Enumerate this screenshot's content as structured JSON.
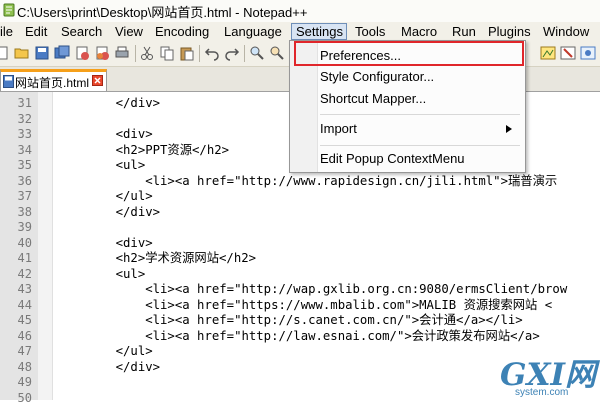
{
  "window": {
    "title": "C:\\Users\\print\\Desktop\\网站首页.html - Notepad++"
  },
  "menu": {
    "items": [
      "ile",
      "Edit",
      "Search",
      "View",
      "Encoding",
      "Language",
      "Settings",
      "Tools",
      "Macro",
      "Run",
      "Plugins",
      "Window"
    ],
    "active": "Settings"
  },
  "toolbar": {
    "buttons": [
      "new-file-icon",
      "open-file-icon",
      "save-icon",
      "save-all-icon",
      "close-icon",
      "close-all-icon",
      "print-icon",
      "cut-icon",
      "copy-icon",
      "paste-icon",
      "undo-icon",
      "redo-icon",
      "find-icon",
      "replace-icon",
      "zoom-in-icon",
      "zoom-out-icon",
      "sync-icon",
      "wrap-icon",
      "function-list-icon",
      "doc-map-icon",
      "record-icon"
    ]
  },
  "tab": {
    "label": "网站首页.html"
  },
  "settings_menu": {
    "items": [
      {
        "label": "Preferences..."
      },
      {
        "label": "Style Configurator..."
      },
      {
        "label": "Shortcut Mapper..."
      },
      {
        "label": "Import"
      },
      {
        "label": "Edit Popup ContextMenu"
      }
    ]
  },
  "editor": {
    "lines": [
      {
        "num": "31",
        "text": "    </div>"
      },
      {
        "num": "32",
        "text": ""
      },
      {
        "num": "33",
        "text": "    <div>"
      },
      {
        "num": "34",
        "text": "    <h2>PPT资源</h2>"
      },
      {
        "num": "35",
        "text": "    <ul>"
      },
      {
        "num": "36",
        "text": "        <li><a href=\"http://www.rapidesign.cn/jili.html\">瑞普演示"
      },
      {
        "num": "37",
        "text": "    </ul>"
      },
      {
        "num": "38",
        "text": "    </div>"
      },
      {
        "num": "39",
        "text": ""
      },
      {
        "num": "40",
        "text": "    <div>"
      },
      {
        "num": "41",
        "text": "    <h2>学术资源网站</h2>"
      },
      {
        "num": "42",
        "text": "    <ul>"
      },
      {
        "num": "43",
        "text": "        <li><a href=\"http://wap.gxlib.org.cn:9080/ermsClient/brow"
      },
      {
        "num": "44",
        "text": "        <li><a href=\"https://www.mbalib.com\">MALIB 资源搜索网站 <"
      },
      {
        "num": "45",
        "text": "        <li><a href=\"http://s.canet.com.cn/\">会计通</a></li>"
      },
      {
        "num": "46",
        "text": "        <li><a href=\"http://law.esnai.com/\">会计政策发布网站</a>"
      },
      {
        "num": "47",
        "text": "    </ul>"
      },
      {
        "num": "48",
        "text": "    </div>"
      },
      {
        "num": "49",
        "text": ""
      },
      {
        "num": "50",
        "text": ""
      }
    ]
  },
  "watermark": {
    "brand": "GXI网",
    "site": "system.com"
  },
  "colors": {
    "highlight": "#e0262b",
    "tab_accent": "#f6a01a",
    "watermark": "#3d82b5"
  }
}
